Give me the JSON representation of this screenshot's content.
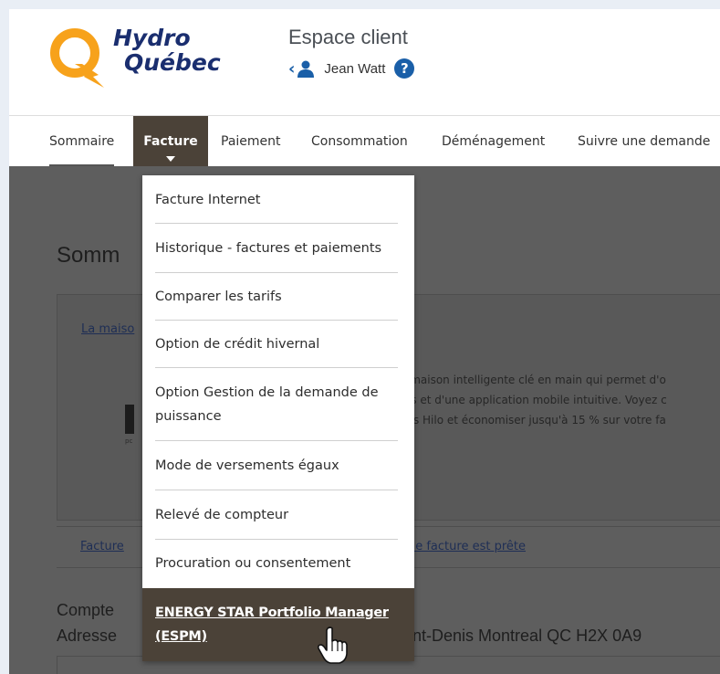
{
  "header": {
    "logo_line1": "Hydro",
    "logo_line2": "Québec",
    "title": "Espace client",
    "user_name": "Jean Watt",
    "help_label": "?"
  },
  "nav": {
    "items": [
      {
        "label": "Sommaire"
      },
      {
        "label": "Facture"
      },
      {
        "label": "Paiement"
      },
      {
        "label": "Consommation"
      },
      {
        "label": "Déménagement"
      },
      {
        "label": "Suivre une demande"
      }
    ]
  },
  "dropdown": {
    "items": [
      {
        "label": "Facture Internet"
      },
      {
        "label": "Historique - factures et paiements"
      },
      {
        "label": "Comparer les tarifs"
      },
      {
        "label": "Option de crédit hivernal"
      },
      {
        "label_line1": "Option Gestion de la demande de",
        "label_line2": "puissance"
      },
      {
        "label": "Mode de versements égaux"
      },
      {
        "label": "Relevé de compteur"
      },
      {
        "label": "Procuration ou consentement"
      },
      {
        "label_line1": "ENERGY STAR Portfolio Manager",
        "label_line2": "(ESPM)"
      }
    ]
  },
  "background": {
    "page_title": "Somm",
    "maison_link": "La maiso",
    "desc_line1": "e maison intelligente clé en main qui permet d'o",
    "desc_line2": "nts et d'une application mobile intuitive. Voyez c",
    "desc_line3": "efis Hilo et économiser jusqu'à 15 % sur votre fa",
    "hilo_small": "pc",
    "facture_link": "Facture",
    "nouvelle_facture_link": "elle facture est prête",
    "compte_label": "Compte",
    "adresse_label": "Adresse",
    "adresse_value": "aint-Denis Montreal QC H2X 0A9"
  },
  "colors": {
    "brand_orange": "#f7a21b",
    "brand_navy": "#1a2e6f",
    "nav_active_bg": "#4b4238",
    "help_blue": "#1a5fa8",
    "overlay": "#5e5e5e"
  }
}
